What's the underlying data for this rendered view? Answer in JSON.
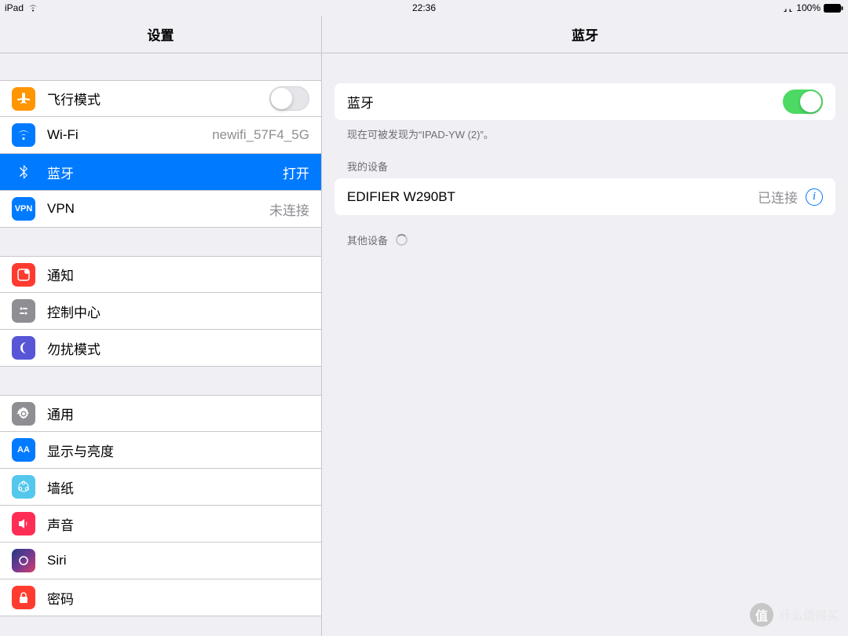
{
  "status": {
    "device": "iPad",
    "time": "22:36",
    "battery": "100%"
  },
  "sidebar": {
    "title": "设置",
    "groups": [
      [
        {
          "id": "airplane",
          "label": "飞行模式",
          "toggle": false
        },
        {
          "id": "wifi",
          "label": "Wi-Fi",
          "value": "newifi_57F4_5G"
        },
        {
          "id": "bluetooth",
          "label": "蓝牙",
          "value": "打开",
          "selected": true
        },
        {
          "id": "vpn",
          "label": "VPN",
          "value": "未连接"
        }
      ],
      [
        {
          "id": "notify",
          "label": "通知"
        },
        {
          "id": "control",
          "label": "控制中心"
        },
        {
          "id": "dnd",
          "label": "勿扰模式"
        }
      ],
      [
        {
          "id": "general",
          "label": "通用"
        },
        {
          "id": "display",
          "label": "显示与亮度"
        },
        {
          "id": "wallpaper",
          "label": "墙纸"
        },
        {
          "id": "sound",
          "label": "声音"
        },
        {
          "id": "siri",
          "label": "Siri"
        },
        {
          "id": "passcode",
          "label": "密码"
        }
      ]
    ]
  },
  "detail": {
    "title": "蓝牙",
    "bt_label": "蓝牙",
    "bt_toggle": true,
    "discoverable": "现在可被发现为“IPAD-YW (2)”。",
    "my_devices_label": "我的设备",
    "devices": [
      {
        "name": "EDIFIER W290BT",
        "status": "已连接"
      }
    ],
    "other_devices_label": "其他设备"
  },
  "watermark": {
    "badge": "值",
    "text": "什么值得买"
  }
}
